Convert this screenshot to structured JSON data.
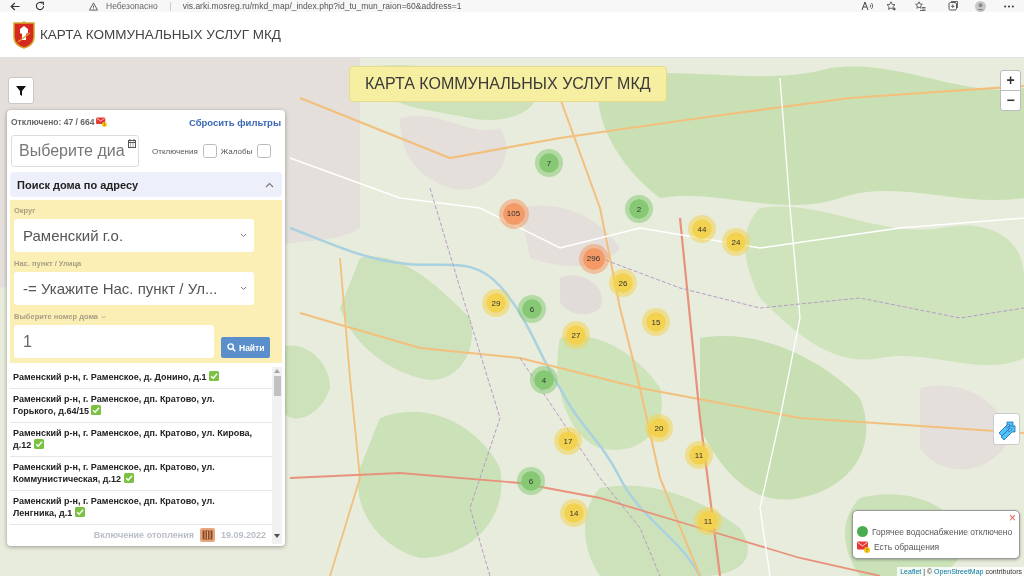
{
  "browser": {
    "security_label": "Небезопасно",
    "url": "vis.arki.mosreg.ru/mkd_map/_index.php?id_tu_mun_raion=60&address=1"
  },
  "header": {
    "title": "КАРТА КОММУНАЛЬНЫХ УСЛУГ МКД"
  },
  "map": {
    "banner": "КАРТА КОММУНАЛЬНЫХ УСЛУГ МКД",
    "zoom_in": "+",
    "zoom_out": "−",
    "clusters": [
      {
        "count": "7",
        "color": "#86c873"
      },
      {
        "count": "105",
        "color": "#f39a66"
      },
      {
        "count": "2",
        "color": "#86c873"
      },
      {
        "count": "44",
        "color": "#f3d24f"
      },
      {
        "count": "24",
        "color": "#f3d24f"
      },
      {
        "count": "296",
        "color": "#f39a66"
      },
      {
        "count": "26",
        "color": "#f3d24f"
      },
      {
        "count": "29",
        "color": "#f3d24f"
      },
      {
        "count": "6",
        "color": "#86c873"
      },
      {
        "count": "15",
        "color": "#f3d24f"
      },
      {
        "count": "27",
        "color": "#f3d24f"
      },
      {
        "count": "4",
        "color": "#86c873"
      },
      {
        "count": "17",
        "color": "#f3d24f"
      },
      {
        "count": "20",
        "color": "#f3d24f"
      },
      {
        "count": "11",
        "color": "#f3d24f"
      },
      {
        "count": "6",
        "color": "#86c873"
      },
      {
        "count": "14",
        "color": "#f3d24f"
      },
      {
        "count": "11",
        "color": "#f3d24f"
      }
    ],
    "attribution": [
      {
        "kind": "link",
        "text": "Leaflet"
      },
      {
        "kind": "text",
        "text": "| ©"
      },
      {
        "kind": "link",
        "text": "OpenStreetMap"
      },
      {
        "kind": "text",
        "text": "contributors"
      }
    ]
  },
  "panel": {
    "stats": "Отключено: 47 / 664",
    "reset_link": "Сбросить фильтры",
    "date_field": {
      "placeholder": "Выберите диа"
    },
    "checkboxes": [
      {
        "label": "Отключения",
        "checked": false
      },
      {
        "label": "Жалобы",
        "checked": false
      }
    ],
    "search": {
      "title": "Поиск дома по адресу",
      "expanded": true,
      "district_label": "Округ",
      "district_value": "Раменский г.о.",
      "street_label": "Нас. пункт / Улица",
      "street_value": "-= Укажите Нас. пункт / Ул...",
      "house_label": "Выберите номер дома",
      "house_value": "1",
      "find_button": "Найти"
    },
    "results": [
      {
        "address": "Раменский р-н, г. Раменское, д. Донино, д.1"
      },
      {
        "address": "Раменский р-н, г. Раменское, дп. Кратово, ул. Горького, д.64/15"
      },
      {
        "address": "Раменский р-н, г. Раменское, дп. Кратово, ул. Кирова, д.12"
      },
      {
        "address": "Раменский р-н, г. Раменское, дп. Кратово, ул. Коммунистическая, д.12"
      },
      {
        "address": "Раменский р-н, г. Раменское, дп. Кратово, ул. Ленгника, д.1"
      }
    ],
    "footer": {
      "label": "Включение отопления",
      "date": "19.09.2022"
    }
  },
  "legend": {
    "close": "×",
    "items": [
      {
        "kind": "dot",
        "label": "Горячее водоснабжение отключено"
      },
      {
        "kind": "envelope",
        "label": "Есть обращения"
      }
    ]
  }
}
